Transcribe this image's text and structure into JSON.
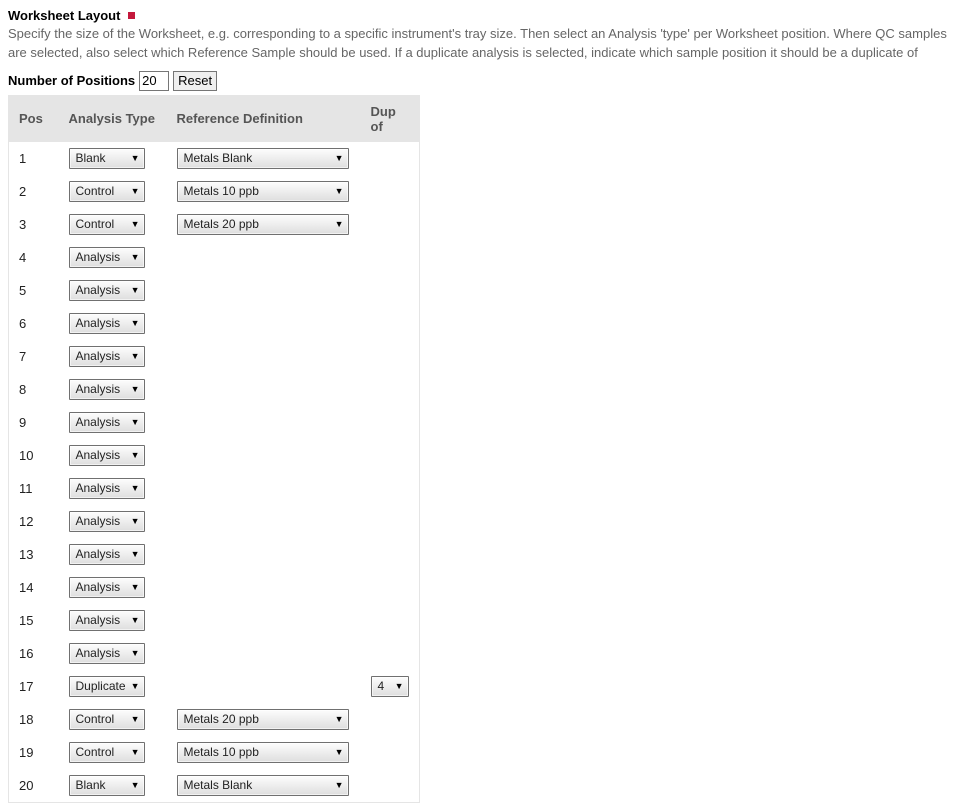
{
  "heading": "Worksheet Layout",
  "description": "Specify the size of the Worksheet, e.g. corresponding to a specific instrument's tray size. Then select an Analysis 'type' per Worksheet position. Where QC samples are selected, also select which Reference Sample should be used. If a duplicate analysis is selected, indicate which sample position it should be a duplicate of",
  "numPositionsLabel": "Number of Positions",
  "numPositionsValue": "20",
  "resetLabel": "Reset",
  "columns": {
    "pos": "Pos",
    "type": "Analysis Type",
    "ref": "Reference Definition",
    "dup": "Dup of"
  },
  "rows": [
    {
      "pos": "1",
      "type": "Blank",
      "ref": "Metals Blank",
      "dup": ""
    },
    {
      "pos": "2",
      "type": "Control",
      "ref": "Metals 10 ppb",
      "dup": ""
    },
    {
      "pos": "3",
      "type": "Control",
      "ref": "Metals 20 ppb",
      "dup": ""
    },
    {
      "pos": "4",
      "type": "Analysis",
      "ref": "",
      "dup": ""
    },
    {
      "pos": "5",
      "type": "Analysis",
      "ref": "",
      "dup": ""
    },
    {
      "pos": "6",
      "type": "Analysis",
      "ref": "",
      "dup": ""
    },
    {
      "pos": "7",
      "type": "Analysis",
      "ref": "",
      "dup": ""
    },
    {
      "pos": "8",
      "type": "Analysis",
      "ref": "",
      "dup": ""
    },
    {
      "pos": "9",
      "type": "Analysis",
      "ref": "",
      "dup": ""
    },
    {
      "pos": "10",
      "type": "Analysis",
      "ref": "",
      "dup": ""
    },
    {
      "pos": "11",
      "type": "Analysis",
      "ref": "",
      "dup": ""
    },
    {
      "pos": "12",
      "type": "Analysis",
      "ref": "",
      "dup": ""
    },
    {
      "pos": "13",
      "type": "Analysis",
      "ref": "",
      "dup": ""
    },
    {
      "pos": "14",
      "type": "Analysis",
      "ref": "",
      "dup": ""
    },
    {
      "pos": "15",
      "type": "Analysis",
      "ref": "",
      "dup": ""
    },
    {
      "pos": "16",
      "type": "Analysis",
      "ref": "",
      "dup": ""
    },
    {
      "pos": "17",
      "type": "Duplicate",
      "ref": "",
      "dup": "4"
    },
    {
      "pos": "18",
      "type": "Control",
      "ref": "Metals 20 ppb",
      "dup": ""
    },
    {
      "pos": "19",
      "type": "Control",
      "ref": "Metals 10 ppb",
      "dup": ""
    },
    {
      "pos": "20",
      "type": "Blank",
      "ref": "Metals Blank",
      "dup": ""
    }
  ]
}
